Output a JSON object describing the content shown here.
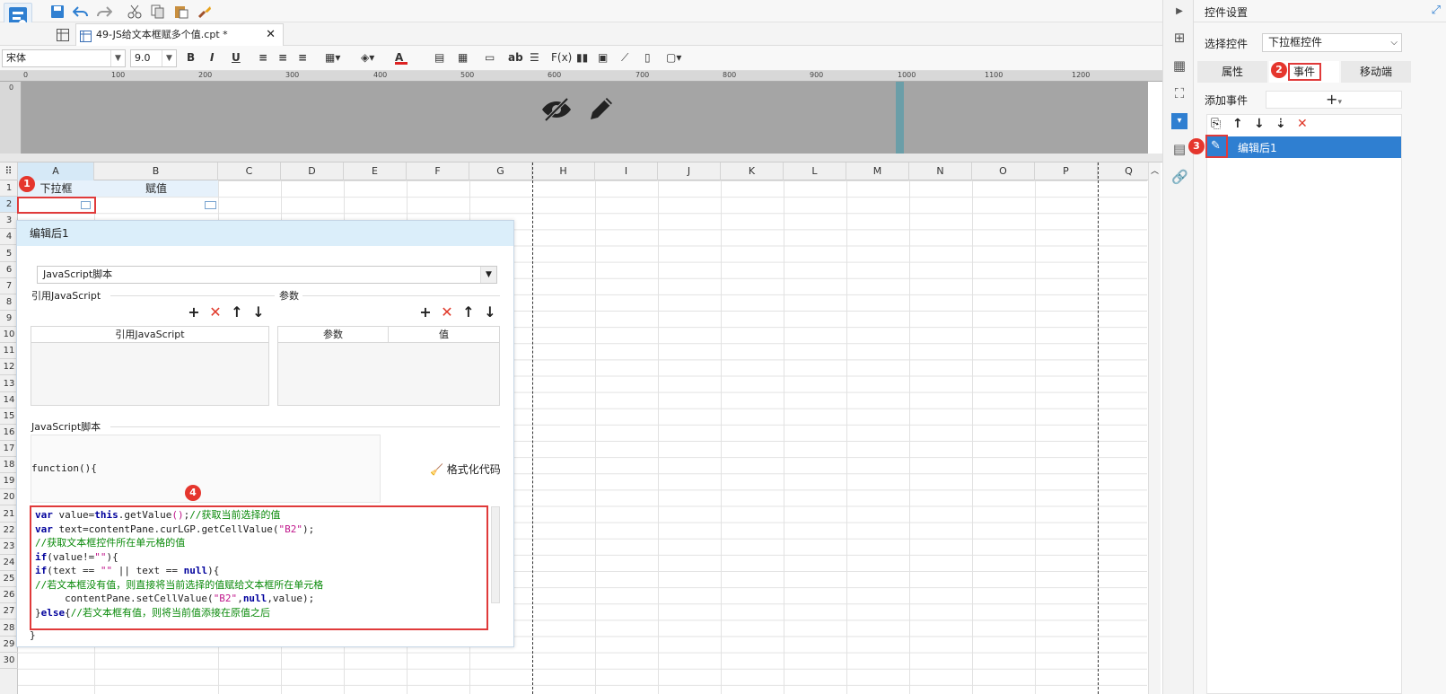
{
  "toolbar": {
    "doc_tab": "49-JS给文本框赋多个值.cpt *",
    "font_name": "宋体",
    "font_size": "9.0"
  },
  "header_area": {
    "ruler_ticks": [
      "0",
      "100",
      "200",
      "300",
      "400",
      "500",
      "600",
      "700",
      "800",
      "900",
      "1000",
      "1100",
      "1200"
    ],
    "vruler_tick": "0"
  },
  "grid": {
    "columns": [
      "A",
      "B",
      "C",
      "D",
      "E",
      "F",
      "G",
      "H",
      "I",
      "J",
      "K",
      "L",
      "M",
      "N",
      "O",
      "P",
      "Q"
    ],
    "rows": [
      "1",
      "2",
      "3",
      "4",
      "5",
      "6",
      "7",
      "8",
      "9",
      "10",
      "11",
      "12",
      "13",
      "14",
      "15",
      "16",
      "17",
      "18",
      "19",
      "20",
      "21",
      "22",
      "23",
      "24",
      "25",
      "26",
      "27",
      "28",
      "29",
      "30"
    ],
    "a1": "下拉框",
    "b1": "赋值"
  },
  "dialog": {
    "title": "编辑后1",
    "type_select": "JavaScript脚本",
    "ref_js_label": "引用JavaScript",
    "param_label": "参数",
    "ref_col": "引用JavaScript",
    "param_col": "参数",
    "value_col": "值",
    "script_label": "JavaScript脚本",
    "function_head": "function(){",
    "format_button": "格式化代码"
  },
  "code_lines": [
    [
      [
        "kw",
        "var"
      ],
      [
        "fn",
        " value="
      ],
      [
        "kw",
        "this"
      ],
      [
        "fn",
        ".getValue"
      ],
      [
        "st",
        "()"
      ],
      [
        "fn",
        ";"
      ],
      [
        "cm",
        "//获取当前选择的值"
      ]
    ],
    [
      [
        "kw",
        "var"
      ],
      [
        "fn",
        " text=contentPane.curLGP.getCellValue("
      ],
      [
        "st",
        "\"B2\""
      ],
      [
        "fn",
        ");"
      ]
    ],
    [
      [
        "cm",
        "//获取文本框控件所在单元格的值"
      ]
    ],
    [
      [
        "kw",
        "if"
      ],
      [
        "fn",
        "(value!="
      ],
      [
        "st",
        "\"\""
      ],
      [
        "fn",
        "){"
      ]
    ],
    [
      [
        "kw",
        "if"
      ],
      [
        "fn",
        "(text == "
      ],
      [
        "st",
        "\"\""
      ],
      [
        "fn",
        " || text == "
      ],
      [
        "kw",
        "null"
      ],
      [
        "fn",
        "){"
      ]
    ],
    [
      [
        "cm",
        "//若文本框没有值，则直接将当前选择的值赋给文本框所在单元格"
      ]
    ],
    [
      [
        "fn",
        "     contentPane.setCellValue("
      ],
      [
        "st",
        "\"B2\""
      ],
      [
        "fn",
        ","
      ],
      [
        "kw",
        "null"
      ],
      [
        "fn",
        ",value);"
      ]
    ],
    [
      [
        "fn",
        "}"
      ],
      [
        "kw",
        "else"
      ],
      [
        "fn",
        "{"
      ],
      [
        "cm",
        "//若文本框有值，则将当前值添接在原值之后"
      ]
    ]
  ],
  "right_panel": {
    "title": "控件设置",
    "select_label": "选择控件",
    "select_value": "下拉框控件",
    "tabs": [
      "属性",
      "事件",
      "移动端"
    ],
    "add_event_label": "添加事件",
    "event_item": "编辑后1"
  },
  "badges": [
    "1",
    "2",
    "3",
    "4"
  ]
}
